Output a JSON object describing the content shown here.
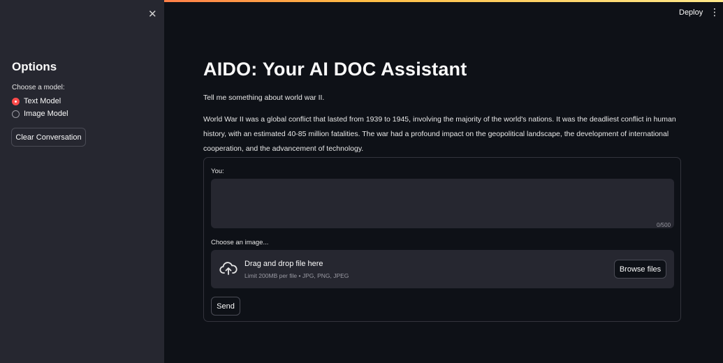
{
  "sidebar": {
    "close_icon": "close-icon",
    "title": "Options",
    "model_label": "Choose a model:",
    "models": [
      {
        "label": "Text Model",
        "selected": true
      },
      {
        "label": "Image Model",
        "selected": false
      }
    ],
    "clear_button": "Clear Conversation"
  },
  "header": {
    "deploy": "Deploy",
    "menu_icon": "kebab-menu-icon"
  },
  "main": {
    "title": "AIDO: Your AI DOC Assistant",
    "user_message": "Tell me something about world war II.",
    "assistant_message": "World War II was a global conflict that lasted from 1939 to 1945, involving the majority of the world's nations. It was the deadliest conflict in human history, with an estimated 40-85 million fatalities. The war had a profound impact on the geopolitical landscape, the development of international cooperation, and the advancement of technology."
  },
  "form": {
    "you_label": "You:",
    "text_value": "",
    "char_counter": "0/500",
    "image_label": "Choose an image...",
    "upload_icon": "cloud-upload-icon",
    "dropzone_title": "Drag and drop file here",
    "dropzone_limit": "Limit 200MB per file • JPG, PNG, JPEG",
    "browse_button": "Browse files",
    "send_button": "Send"
  },
  "colors": {
    "accent": "#ff4b4b",
    "background": "#0e1117",
    "sidebar": "#262730"
  }
}
